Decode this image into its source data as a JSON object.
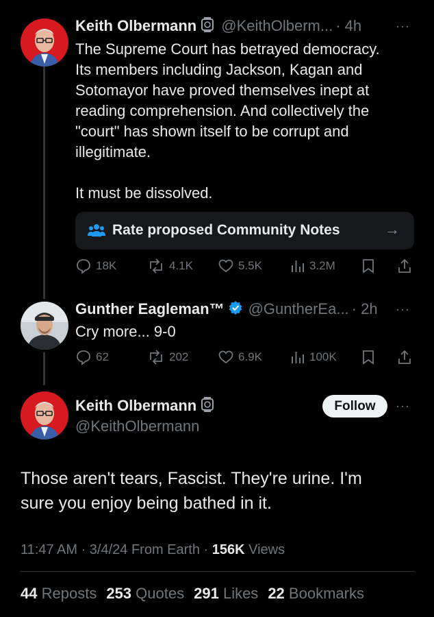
{
  "tweet1": {
    "name": "Keith Olbermann",
    "handle": "@KeithOlberm...",
    "time": "· 4h",
    "more": "···",
    "lines": [
      "The Supreme Court has betrayed democracy.",
      "Its members including Jackson, Kagan and",
      "Sotomayor have proved themselves inept at",
      "reading comprehension. And collectively the",
      "\"court\" has shown itself to be corrupt and",
      "illegitimate.",
      "It must be dissolved."
    ],
    "notes_label": "Rate proposed Community Notes",
    "notes_arrow": "→",
    "replies": "18K",
    "reposts": "4.1K",
    "likes": "5.5K",
    "views": "3.2M"
  },
  "tweet2": {
    "name": "Gunther Eagleman™",
    "handle": "@GuntherEa...",
    "time": "· 2h",
    "more": "···",
    "text": "Cry more... 9-0",
    "replies": "62",
    "reposts": "202",
    "likes": "6.9K",
    "views": "100K"
  },
  "tweet3": {
    "name": "Keith Olbermann",
    "handle": "@KeithOlbermann",
    "follow_label": "Follow",
    "more": "···",
    "lines": [
      "Those aren't tears, Fascist. They're urine. I'm",
      "sure you enjoy being bathed in it."
    ],
    "meta_time": "11:47 AM · 3/4/24 From Earth · ",
    "meta_views_num": "156K",
    "meta_views_lbl": " Views",
    "stats": [
      {
        "num": "44",
        "label": "Reposts"
      },
      {
        "num": "253",
        "label": "Quotes"
      },
      {
        "num": "291",
        "label": "Likes"
      },
      {
        "num": "22",
        "label": "Bookmarks"
      }
    ]
  },
  "colors": {
    "background": "#000000",
    "text": "#e7e9ea",
    "muted": "#71767b",
    "verified": "#1d9bf0",
    "notes_box": "#16181c"
  }
}
